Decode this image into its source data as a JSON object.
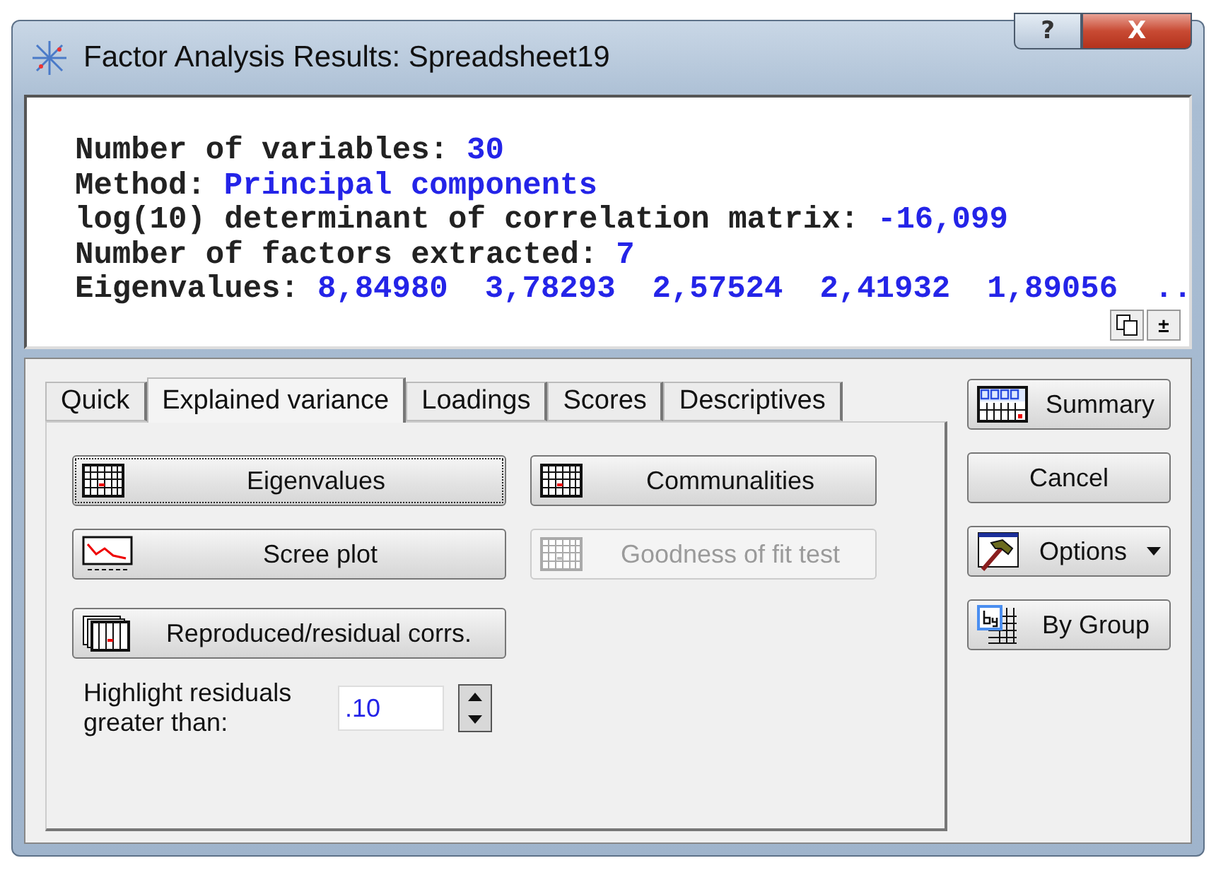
{
  "window": {
    "title": "Factor Analysis Results: Spreadsheet19",
    "controls": [
      {
        "kind": "help",
        "label": "?"
      },
      {
        "kind": "close",
        "label": "X"
      }
    ]
  },
  "output": {
    "lines": [
      {
        "label": "Number of variables:",
        "values": [
          "30"
        ]
      },
      {
        "label": "Method:",
        "values": [
          "Principal components"
        ]
      },
      {
        "label": "log(10) determinant of correlation matrix:",
        "values": [
          "-16,099"
        ]
      },
      {
        "label": "Number of factors extracted:",
        "values": [
          "7"
        ]
      },
      {
        "label": "Eigenvalues:",
        "values": [
          "8,84980",
          "3,78293",
          "2,57524",
          "2,41932",
          "1,89056",
          ".."
        ]
      }
    ],
    "tools": [
      {
        "kind": "copy"
      },
      {
        "kind": "collapse",
        "label": "±"
      }
    ]
  },
  "tabs": [
    {
      "label": "Quick",
      "selected": false
    },
    {
      "label": "Explained variance",
      "selected": true
    },
    {
      "label": "Loadings",
      "selected": false
    },
    {
      "label": "Scores",
      "selected": false
    },
    {
      "label": "Descriptives",
      "selected": false
    }
  ],
  "panel": {
    "buttons": [
      {
        "label": "Eigenvalues",
        "kind": "table",
        "disabled": false,
        "focused": true
      },
      {
        "label": "Communalities",
        "kind": "table",
        "disabled": false,
        "focused": false
      },
      {
        "label": "Scree plot",
        "kind": "plot",
        "disabled": false,
        "focused": false
      },
      {
        "label": "Goodness of fit test",
        "kind": "table",
        "disabled": true,
        "focused": false
      }
    ],
    "wide_button": {
      "label": "Reproduced/residual corrs.",
      "kind": "stack"
    },
    "spin": {
      "label": "Highlight residuals greater than:",
      "value": ".10"
    }
  },
  "side_buttons": [
    {
      "label": "Summary",
      "kind": "summary"
    },
    {
      "label": "Cancel",
      "kind": "plain"
    },
    {
      "label": "Options",
      "kind": "options"
    },
    {
      "label": "By Group",
      "kind": "bygroup"
    }
  ]
}
